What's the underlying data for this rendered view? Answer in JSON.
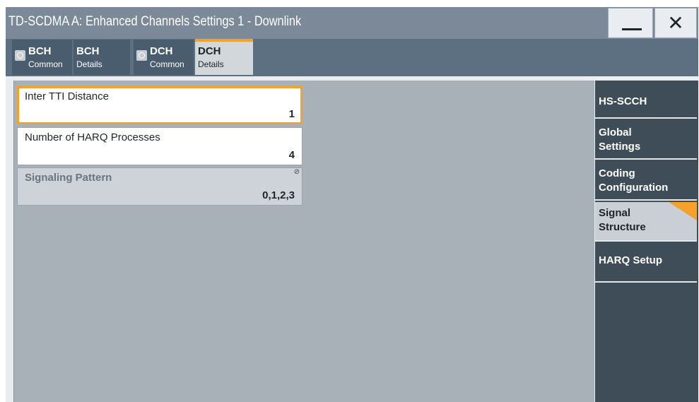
{
  "window": {
    "title": "TD-SCDMA A: Enhanced Channels Settings 1 - Downlink",
    "minimize_label": "—",
    "close_label": "✕"
  },
  "tabs": [
    {
      "line1": "BCH",
      "line2": "Common",
      "has_checkbox": true,
      "active": false
    },
    {
      "line1": "BCH",
      "line2": "Details",
      "has_checkbox": false,
      "active": false
    },
    {
      "line1": "DCH",
      "line2": "Common",
      "has_checkbox": true,
      "active": false
    },
    {
      "line1": "DCH",
      "line2": "Details",
      "has_checkbox": false,
      "active": true
    }
  ],
  "params": {
    "inter_tti": {
      "label": "Inter TTI Distance",
      "value": "1"
    },
    "harq_processes": {
      "label": "Number of HARQ Processes",
      "value": "4"
    },
    "signaling_pattern": {
      "label": "Signaling Pattern",
      "value": "0,1,2,3",
      "lock_icon": "⊘"
    }
  },
  "rightnav": [
    {
      "label": "HS-SCCH",
      "active": false
    },
    {
      "label": "Global\nSettings",
      "line1": "Global",
      "line2": "Settings",
      "active": false
    },
    {
      "label": "Coding\nConfiguration",
      "line1": "Coding",
      "line2": "Configuration",
      "active": false
    },
    {
      "label": "Signal\nStructure",
      "line1": "Signal",
      "line2": "Structure",
      "active": true
    },
    {
      "label": "HARQ Setup",
      "active": false
    }
  ],
  "colors": {
    "accent": "#f5a12a",
    "titlebar": "#7b8998",
    "tabstrip": "#5d7082",
    "nav_dark": "#3f4d59",
    "pane": "#a8b0b8"
  }
}
